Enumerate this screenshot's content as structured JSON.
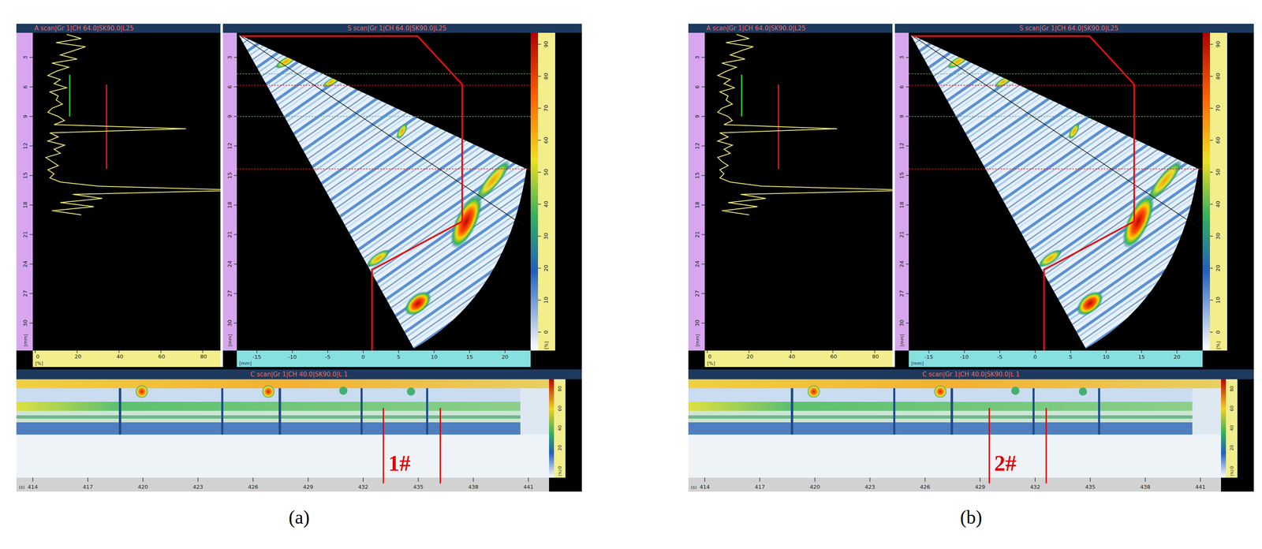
{
  "panels": [
    {
      "caption": "(a)",
      "a_scan": {
        "title": "A scan|Gr 1|CH 64.0|SK90.0|L25",
        "depth_ticks": [
          "3",
          "6",
          "9",
          "12",
          "15",
          "18",
          "21",
          "24",
          "27",
          "30"
        ],
        "depth_unit": "[mm]",
        "amp_ticks": [
          "0",
          "20",
          "40",
          "60",
          "80"
        ],
        "amp_unit": "[%]",
        "trace": [
          15,
          22,
          10,
          24,
          18,
          12,
          20,
          8,
          16,
          10,
          6,
          12,
          9,
          15,
          7,
          11,
          10,
          13,
          8,
          6,
          11,
          14,
          9,
          72,
          7,
          11,
          6,
          14,
          9,
          12,
          5,
          8,
          11,
          6,
          9,
          7,
          12,
          30,
          100,
          18,
          32,
          12,
          28,
          8,
          22
        ]
      },
      "s_scan": {
        "title": "S scan|Gr 1|CH 64.0|SK90.0|L25",
        "depth_ticks": [
          "3",
          "6",
          "9",
          "12",
          "15",
          "18",
          "21",
          "24",
          "27",
          "30"
        ],
        "depth_unit": "[mm]",
        "x_ticks": [
          "-15",
          "-10",
          "-5",
          "0",
          "5",
          "10",
          "15",
          "20"
        ],
        "x_unit": "[mm]",
        "color_ticks": [
          "0",
          "10",
          "20",
          "30",
          "40",
          "50",
          "60",
          "70",
          "80",
          "90"
        ],
        "color_unit": "[%]"
      },
      "c_scan": {
        "title": "C scan|Gr 1|CH 40.0|SK90.0|L 1",
        "time_ticks": [
          "414",
          "417",
          "420",
          "423",
          "426",
          "429",
          "432",
          "435",
          "438",
          "441"
        ],
        "time_unit": "(s)",
        "color_ticks": [
          "0",
          "20",
          "40",
          "60",
          "80"
        ],
        "color_unit": "[%]",
        "gate": {
          "label": "1#",
          "start": 433.1,
          "end": 436.2
        }
      }
    },
    {
      "caption": "(b)",
      "a_scan": {
        "title": "A scan|Gr 1|CH 64.0|SK90.0|L25",
        "depth_ticks": [
          "3",
          "6",
          "9",
          "12",
          "15",
          "18",
          "21",
          "24",
          "27",
          "30"
        ],
        "depth_unit": "[mm]",
        "amp_ticks": [
          "0",
          "20",
          "40",
          "60",
          "80"
        ],
        "amp_unit": "[%]",
        "trace": [
          14,
          20,
          9,
          22,
          16,
          11,
          18,
          7,
          14,
          9,
          5,
          11,
          8,
          13,
          6,
          10,
          9,
          12,
          7,
          5,
          10,
          12,
          8,
          62,
          6,
          10,
          5,
          12,
          8,
          11,
          5,
          7,
          10,
          6,
          8,
          6,
          11,
          26,
          100,
          16,
          28,
          10,
          24,
          7,
          20
        ]
      },
      "s_scan": {
        "title": "S scan|Gr 1|CH 64.0|SK90.0|L25",
        "depth_ticks": [
          "3",
          "6",
          "9",
          "12",
          "15",
          "18",
          "21",
          "24",
          "27",
          "30"
        ],
        "depth_unit": "[mm]",
        "x_ticks": [
          "-15",
          "-10",
          "-5",
          "0",
          "5",
          "10",
          "15",
          "20"
        ],
        "x_unit": "[mm]",
        "color_ticks": [
          "0",
          "10",
          "20",
          "30",
          "40",
          "50",
          "60",
          "70",
          "80",
          "90"
        ],
        "color_unit": "[%]"
      },
      "c_scan": {
        "title": "C scan|Gr 1|CH 40.0|SK90.0|L 1",
        "time_ticks": [
          "414",
          "417",
          "420",
          "423",
          "426",
          "429",
          "432",
          "435",
          "438",
          "441"
        ],
        "time_unit": "(s)",
        "color_ticks": [
          "0",
          "20",
          "40",
          "60",
          "80"
        ],
        "color_unit": "[%]",
        "gate": {
          "label": "2#",
          "start": 429.5,
          "end": 432.6
        }
      }
    }
  ]
}
